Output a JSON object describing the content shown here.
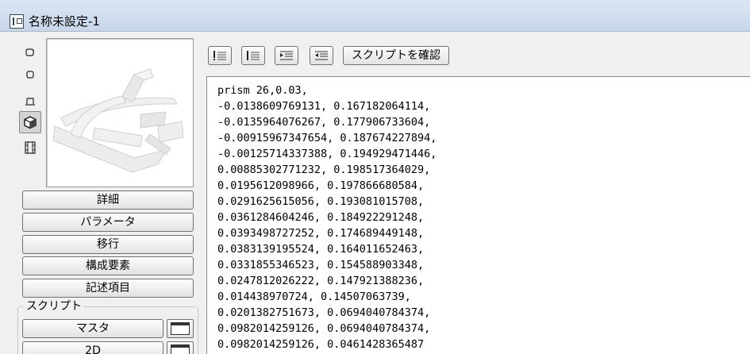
{
  "window": {
    "title": "名称未設定-1"
  },
  "sidebar": {
    "view_icons": [
      "2d-symbol-icon",
      "section-icon",
      "elevation-icon",
      "3d-view-icon",
      "film-icon"
    ],
    "buttons": [
      {
        "label": "詳細"
      },
      {
        "label": "パラメータ"
      },
      {
        "label": "移行"
      },
      {
        "label": "構成要素"
      },
      {
        "label": "記述項目"
      }
    ],
    "script_section": {
      "label": "スクリプト",
      "buttons": [
        {
          "label": "マスタ"
        },
        {
          "label": "2D"
        }
      ]
    }
  },
  "toolbar": {
    "icons": [
      "unordered-list-icon",
      "ordered-list-icon",
      "indent-icon",
      "outdent-icon"
    ],
    "confirm_label": "スクリプトを確認"
  },
  "editor": {
    "lines": [
      "prism 26,0.03,",
      "-0.0138609769131, 0.167182064114,",
      "-0.0135964076267, 0.177906733604,",
      "-0.00915967347654, 0.187674227894,",
      "-0.00125714337388, 0.194929471446,",
      "0.00885302771232, 0.198517364029,",
      "0.0195612098966, 0.197866680584,",
      "0.0291625615056, 0.193081015708,",
      "0.0361284604246, 0.184922291248,",
      "0.0393498727252, 0.174689449148,",
      "0.0383139195524, 0.164011652463,",
      "0.0331855346523, 0.154588903348,",
      "0.0247812026222, 0.147921388236,",
      "0.014438970724, 0.14507063739,",
      "0.0201382751673, 0.0694040784374,",
      "0.0982014259126, 0.0694040784374,",
      "0.0982014259126, 0.0461428365487"
    ]
  }
}
